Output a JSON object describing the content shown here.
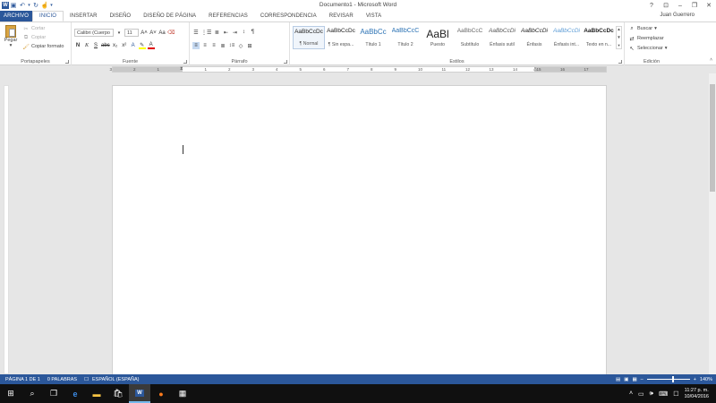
{
  "window": {
    "title": "Documento1 - Microsoft Word",
    "user": "Juan Guerrero",
    "help": "?"
  },
  "qat": {
    "save_icon": "save-icon",
    "undo_icon": "undo-icon",
    "redo_icon": "redo-icon"
  },
  "tabs": [
    {
      "label": "ARCHIVO"
    },
    {
      "label": "INICIO"
    },
    {
      "label": "INSERTAR"
    },
    {
      "label": "DISEÑO"
    },
    {
      "label": "DISEÑO DE PÁGINA"
    },
    {
      "label": "REFERENCIAS"
    },
    {
      "label": "CORRESPONDENCIA"
    },
    {
      "label": "REVISAR"
    },
    {
      "label": "VISTA"
    }
  ],
  "ribbon": {
    "clipboard": {
      "label": "Portapapeles",
      "paste": "Pegar",
      "cut": "Cortar",
      "copy": "Copiar",
      "format_painter": "Copiar formato"
    },
    "font": {
      "label": "Fuente",
      "font_name": "Calibri (Cuerpo",
      "font_size": "11"
    },
    "paragraph": {
      "label": "Párrafo"
    },
    "styles": {
      "label": "Estilos",
      "items": [
        {
          "preview": "AaBbCcDc",
          "name": "¶ Normal"
        },
        {
          "preview": "AaBbCcDc",
          "name": "¶ Sin espa..."
        },
        {
          "preview": "AaBbCc",
          "name": "Título 1"
        },
        {
          "preview": "AaBbCcC",
          "name": "Título 2"
        },
        {
          "preview": "AaBl",
          "name": "Puesto"
        },
        {
          "preview": "AaBbCcC",
          "name": "Subtítulo"
        },
        {
          "preview": "AaBbCcDi",
          "name": "Énfasis sutil"
        },
        {
          "preview": "AaBbCcDi",
          "name": "Énfasis"
        },
        {
          "preview": "AaBbCcDi",
          "name": "Énfasis int..."
        },
        {
          "preview": "AaBbCcDc",
          "name": "Texto en n..."
        }
      ]
    },
    "editing": {
      "label": "Edición",
      "find": "Buscar",
      "replace": "Reemplazar",
      "select": "Seleccionar"
    }
  },
  "ruler": {
    "numbers": [
      "3",
      "2",
      "1",
      "1",
      "2",
      "3",
      "4",
      "5",
      "6",
      "7",
      "8",
      "9",
      "10",
      "11",
      "12",
      "13",
      "14",
      "15",
      "16",
      "17"
    ]
  },
  "status": {
    "page": "PÁGINA 1 DE 1",
    "words": "0 PALABRAS",
    "language": "ESPAÑOL (ESPAÑA)",
    "zoom": "140%",
    "zoom_level": 0.6
  },
  "taskbar": {
    "time": "11:27 p. m.",
    "date": "10/04/2016"
  },
  "colors": {
    "accent": "#2b579a",
    "taskbar": "#101010"
  }
}
